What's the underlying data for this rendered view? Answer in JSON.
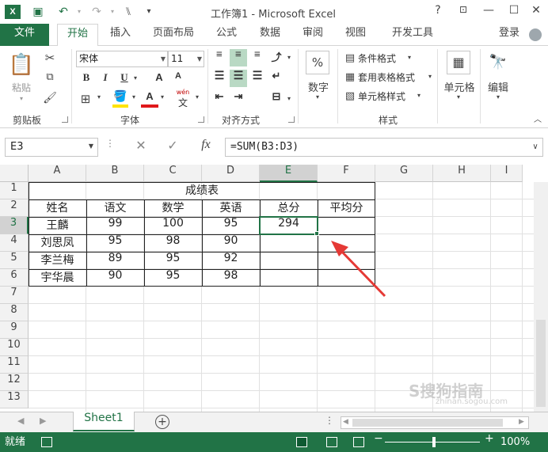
{
  "app": {
    "title": "工作簿1 - Microsoft Excel",
    "help": "?",
    "login": "登录"
  },
  "tabs": [
    "文件",
    "开始",
    "插入",
    "页面布局",
    "公式",
    "数据",
    "审阅",
    "视图",
    "开发工具"
  ],
  "ribbon": {
    "clipboard": {
      "paste": "粘贴",
      "label": "剪贴板"
    },
    "font": {
      "name": "宋体",
      "size": "11",
      "bold": "B",
      "italic": "I",
      "underline": "U",
      "grow": "A",
      "shrink": "A",
      "color_letter": "A",
      "wen": "wén",
      "wen_char": "文",
      "label": "字体"
    },
    "alignment": {
      "label": "对齐方式"
    },
    "number": {
      "symbol": "%",
      "label": "数字"
    },
    "styles": {
      "conditional": "条件格式",
      "table": "套用表格格式",
      "cell": "单元格样式",
      "label": "样式"
    },
    "cells": {
      "label": "单元格"
    },
    "editing": {
      "label": "编辑"
    }
  },
  "formula_bar": {
    "name_box": "E3",
    "formula": "=SUM(B3:D3)",
    "fx": "fx"
  },
  "grid": {
    "columns": [
      "A",
      "B",
      "C",
      "D",
      "E",
      "F",
      "G",
      "H",
      "I"
    ],
    "rows": [
      "1",
      "2",
      "3",
      "4",
      "5",
      "6",
      "7",
      "8",
      "9",
      "10",
      "11",
      "12",
      "13"
    ],
    "selected_column": "E",
    "selected_row": "3",
    "title": "成绩表",
    "headers": [
      "姓名",
      "语文",
      "数学",
      "英语",
      "总分",
      "平均分"
    ],
    "data": [
      [
        "王麟",
        "99",
        "100",
        "95",
        "294",
        ""
      ],
      [
        "刘思凤",
        "95",
        "98",
        "90",
        "",
        ""
      ],
      [
        "李兰梅",
        "89",
        "95",
        "92",
        "",
        ""
      ],
      [
        "宇华晨",
        "90",
        "95",
        "98",
        "",
        ""
      ]
    ]
  },
  "sheets": {
    "tab": "Sheet1",
    "add": "+"
  },
  "status": {
    "ready": "就绪",
    "zoom": "100%",
    "zoom_minus": "−",
    "zoom_plus": "+"
  },
  "watermark": {
    "main": "S搜狗指南",
    "sub": "zhinan.sogou.com"
  },
  "colors": {
    "accent": "#217346",
    "arrow": "#e53935"
  }
}
